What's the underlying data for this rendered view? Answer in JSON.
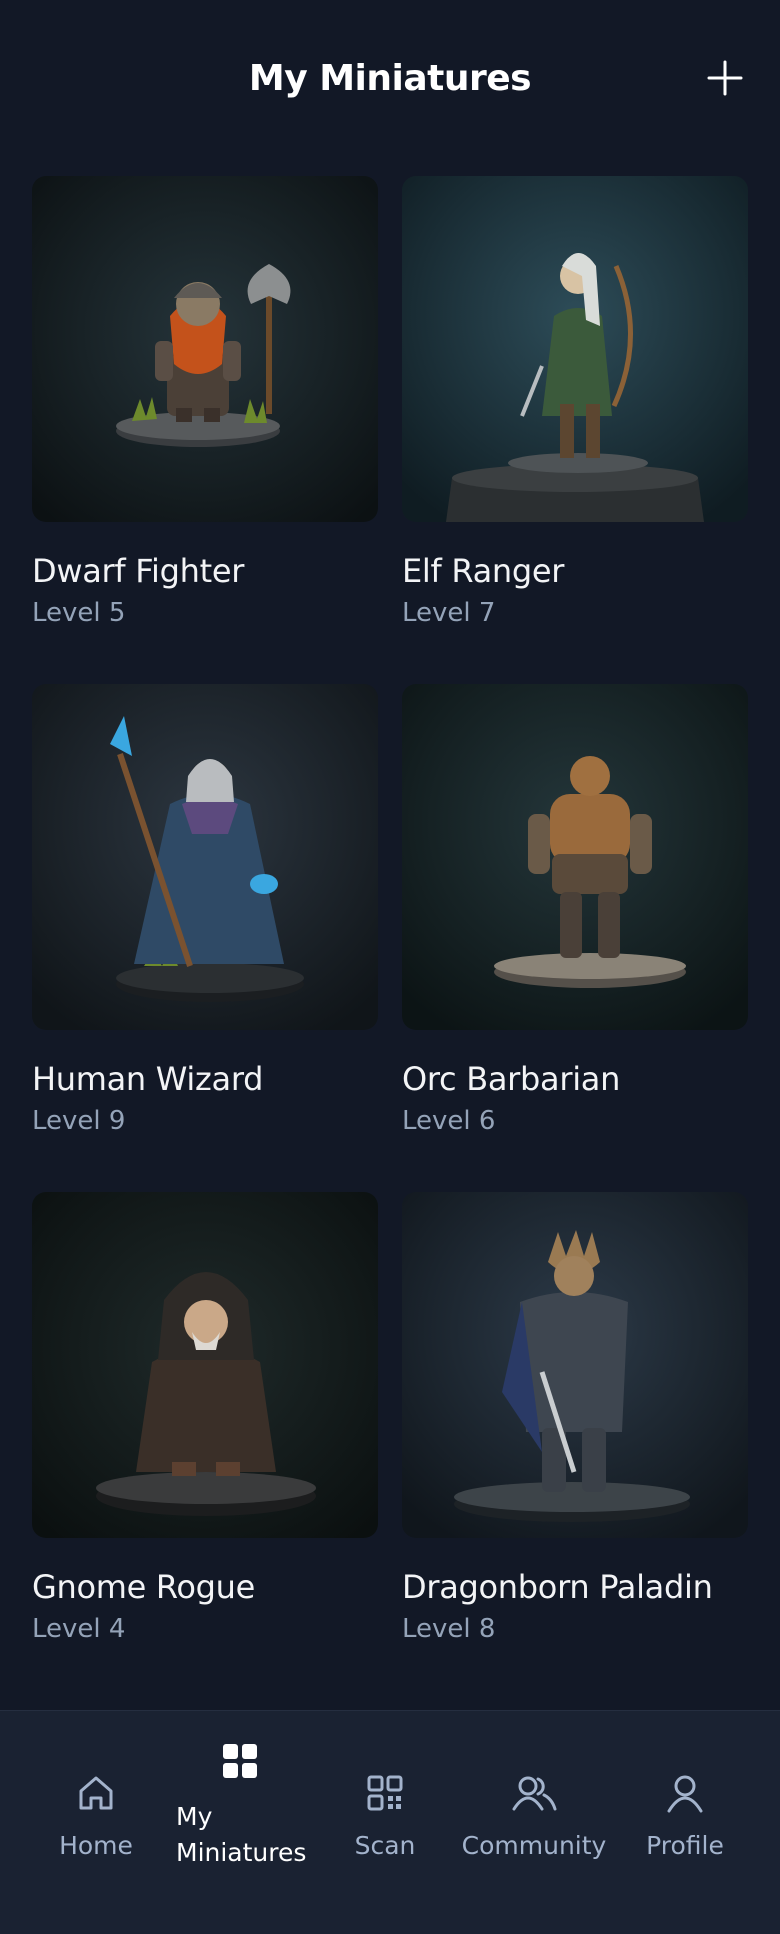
{
  "header": {
    "title": "My Miniatures",
    "add_icon": "plus-icon"
  },
  "miniatures": [
    {
      "name": "Dwarf Fighter",
      "level": "Level 5"
    },
    {
      "name": "Elf Ranger",
      "level": "Level 7"
    },
    {
      "name": "Human Wizard",
      "level": "Level 9"
    },
    {
      "name": "Orc Barbarian",
      "level": "Level 6"
    },
    {
      "name": "Gnome Rogue",
      "level": "Level 4"
    },
    {
      "name": "Dragonborn Paladin",
      "level": "Level 8"
    }
  ],
  "nav": {
    "home": "Home",
    "my_miniatures_line1": "My",
    "my_miniatures_line2": "Miniatures",
    "scan": "Scan",
    "community": "Community",
    "profile": "Profile"
  },
  "colors": {
    "background": "#121826",
    "nav_background": "#1a2232",
    "muted_text": "#94a3b8",
    "active": "#ffffff"
  }
}
